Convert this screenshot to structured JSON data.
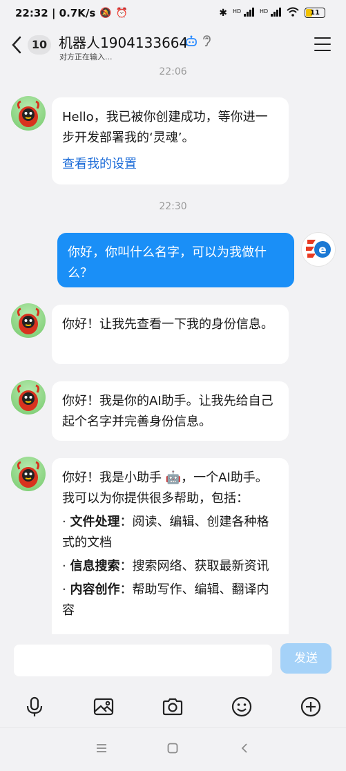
{
  "status": {
    "time_speed": "22:32 | 0.7K/s",
    "hd1": "HD",
    "hd2": "HD",
    "battery": "11"
  },
  "header": {
    "back_icon": "chevron-left-icon",
    "unread_count": "10",
    "title": "机器人1904133664",
    "subtitle": "对方正在输入..."
  },
  "messages": {
    "time1": "22:06",
    "m1_text": "Hello，我已被你创建成功，等你进一步开发部署我的‘灵魂’。",
    "m1_link": "查看我的设置",
    "time2": "22:30",
    "m2_text": "你好，你叫什么名字，可以为我做什么？",
    "m3_text": "你好！让我先查看一下我的身份信息。",
    "m4_text": "你好！我是你的AI助手。让我先给自己起个名字并完善身份信息。",
    "m5_intro": "你好！我是小助手 🤖，一个AI助手。我可以为你提供很多帮助，包括：",
    "m5_items": [
      {
        "bullet": "·",
        "title": "文件处理",
        "desc": "：阅读、编辑、创建各种格式的文档"
      },
      {
        "bullet": "·",
        "title": "信息搜索",
        "desc": "：搜索网络、获取最新资讯"
      },
      {
        "bullet": "·",
        "title": "内容创作",
        "desc": "：帮助写作、编辑、翻译内容"
      }
    ]
  },
  "input": {
    "placeholder": "",
    "send_label": "发送"
  },
  "toolbar": [
    "microphone-icon",
    "image-icon",
    "camera-icon",
    "emoji-icon",
    "plus-icon"
  ],
  "colors": {
    "accent": "#1a8ff7",
    "send_disabled": "#a5d2f8",
    "link": "#1c6cd8",
    "background": "#f2f2f4"
  }
}
